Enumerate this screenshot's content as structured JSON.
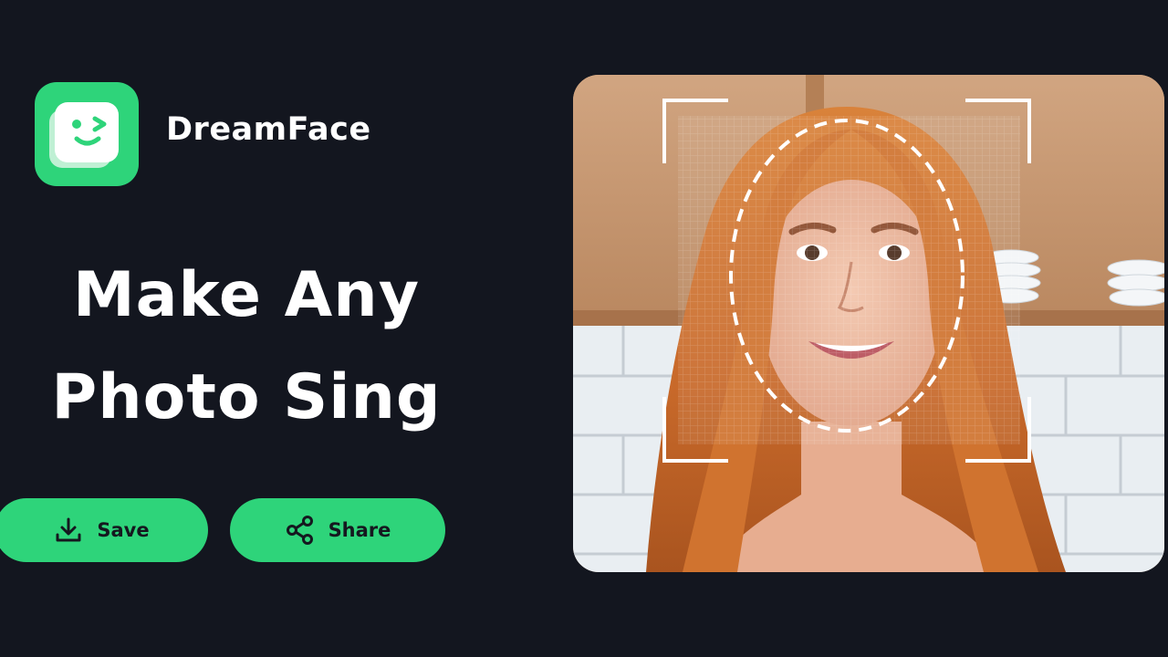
{
  "brand": {
    "name": "DreamFace",
    "logo_icon": "winking-face-icon",
    "accent_color": "#2ed47a"
  },
  "headline": {
    "line1": "Make Any",
    "line2": "Photo Sing"
  },
  "actions": {
    "save_label": "Save",
    "save_icon": "download-icon",
    "share_label": "Share",
    "share_icon": "share-icon"
  },
  "preview": {
    "overlay": "face-scan-frame"
  }
}
